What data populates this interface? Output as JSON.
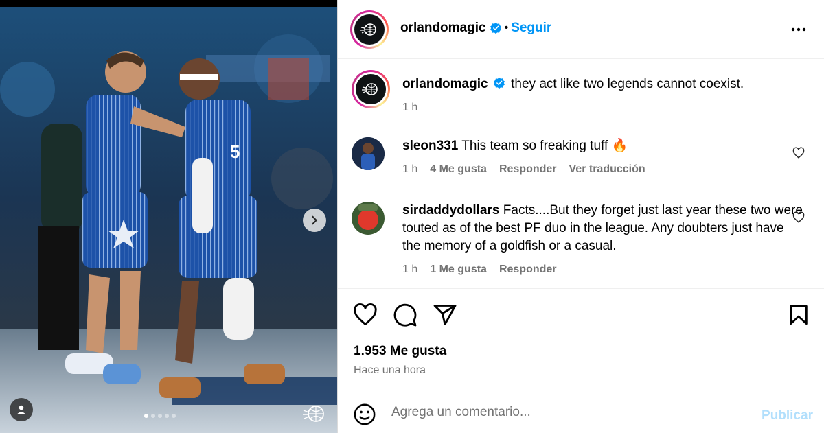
{
  "post": {
    "author": "orlandomagic",
    "follow_label": "Seguir",
    "separator": "•",
    "caption_user": "orlandomagic",
    "caption_text": "they act like two legends cannot coexist.",
    "caption_time": "1 h"
  },
  "comments": [
    {
      "user": "sleon331",
      "text": "This team so freaking tuff 🔥",
      "time": "1 h",
      "likes": "4 Me gusta",
      "reply": "Responder",
      "translate": "Ver traducción"
    },
    {
      "user": "sirdaddydollars",
      "text": "Facts....But they forget just last year these two were touted as of the best PF duo in the league. Any doubters just have the memory of a goldfish or a casual.",
      "time": "1 h",
      "likes": "1 Me gusta",
      "reply": "Responder"
    }
  ],
  "stats": {
    "likes": "1.953 Me gusta",
    "posted": "Hace una hora"
  },
  "composer": {
    "placeholder": "Agrega un comentario...",
    "publish_label": "Publicar"
  },
  "carousel": {
    "total": 5,
    "active_index": 0
  },
  "colors": {
    "accent": "#0095f6",
    "verified": "#0095f6",
    "muted": "#737373",
    "publish_disabled": "#b2dffc",
    "jersey": "#1d52a8"
  },
  "icons": {
    "more": "more-options-icon",
    "like": "heart-icon",
    "comment": "comment-icon",
    "share": "share-icon",
    "save": "bookmark-icon",
    "emoji": "emoji-icon",
    "next": "chevron-right-icon",
    "tagged": "user-tag-icon",
    "verified": "verified-badge-icon"
  }
}
